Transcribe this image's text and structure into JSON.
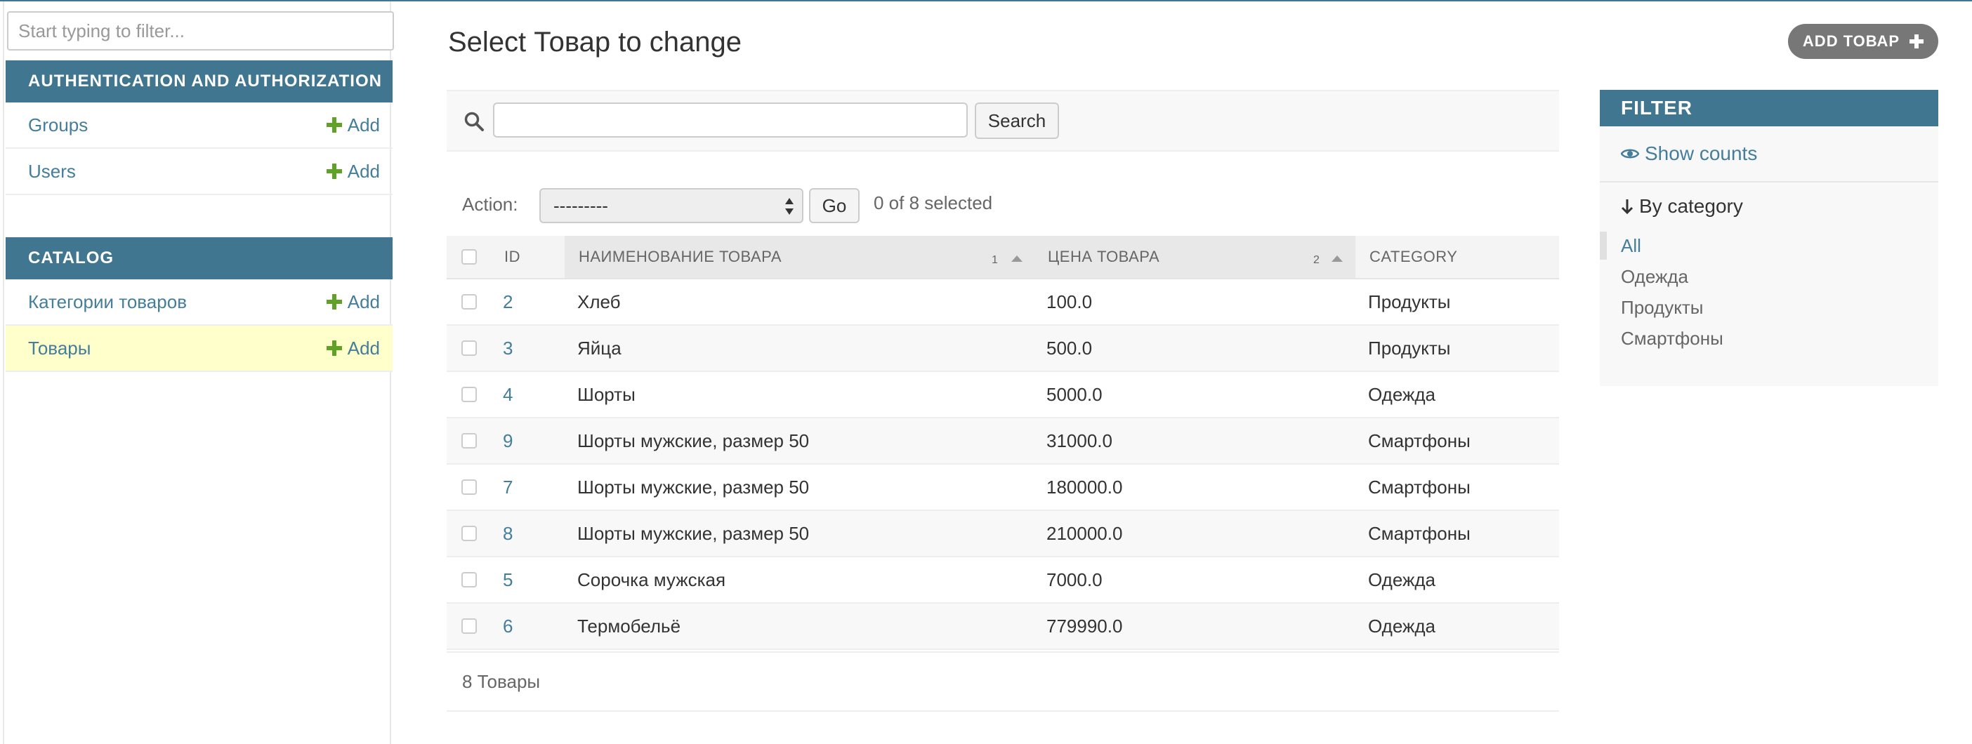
{
  "sidebar": {
    "filter_placeholder": "Start typing to filter...",
    "modules": [
      {
        "caption": "AUTHENTICATION AND AUTHORIZATION",
        "rows": [
          {
            "label": "Groups",
            "add": "Add"
          },
          {
            "label": "Users",
            "add": "Add"
          }
        ]
      },
      {
        "caption": "CATALOG",
        "rows": [
          {
            "label": "Категории товаров",
            "add": "Add"
          },
          {
            "label": "Товары",
            "add": "Add"
          }
        ]
      }
    ]
  },
  "header": {
    "title": "Select Товар to change",
    "add_button": "ADD ТОВАР"
  },
  "search": {
    "value": "",
    "button": "Search"
  },
  "actions": {
    "label": "Action:",
    "selected_option": "---------",
    "go": "Go",
    "selected_count": "0 of 8 selected"
  },
  "table": {
    "columns": [
      {
        "label": "ID"
      },
      {
        "label": "НАИМЕНОВАНИЕ ТОВАРА",
        "sort_priority": "1"
      },
      {
        "label": "ЦЕНА ТОВАРА",
        "sort_priority": "2"
      },
      {
        "label": "CATEGORY"
      }
    ],
    "rows": [
      {
        "id": "2",
        "name": "Хлеб",
        "price": "100.0",
        "category": "Продукты"
      },
      {
        "id": "3",
        "name": "Яйца",
        "price": "500.0",
        "category": "Продукты"
      },
      {
        "id": "4",
        "name": "Шорты",
        "price": "5000.0",
        "category": "Одежда"
      },
      {
        "id": "9",
        "name": "Шорты мужские, размер 50",
        "price": "31000.0",
        "category": "Смартфоны"
      },
      {
        "id": "7",
        "name": "Шорты мужские, размер 50",
        "price": "180000.0",
        "category": "Смартфоны"
      },
      {
        "id": "8",
        "name": "Шорты мужские, размер 50",
        "price": "210000.0",
        "category": "Смартфоны"
      },
      {
        "id": "5",
        "name": "Сорочка мужская",
        "price": "7000.0",
        "category": "Одежда"
      },
      {
        "id": "6",
        "name": "Термобельё",
        "price": "779990.0",
        "category": "Одежда"
      }
    ],
    "paginator": "8 Товары"
  },
  "filter": {
    "caption": "FILTER",
    "show_counts": "Show counts",
    "by_category": "By category",
    "options": [
      "All",
      "Одежда",
      "Продукты",
      "Смартфоны"
    ],
    "selected": "All"
  },
  "colors": {
    "accent": "#417690",
    "link": "#447e9b",
    "add_green": "#5fa225",
    "current_row": "#ffffcc"
  }
}
